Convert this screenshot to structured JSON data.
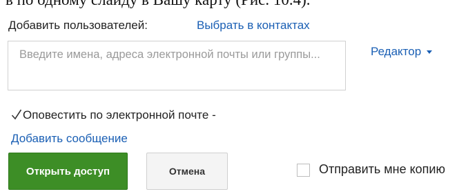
{
  "page_fragment": {
    "cropped_text": "в по одному слайду в Вашу карту (Рис. 10.4)."
  },
  "share_dialog": {
    "add_users_label": "Добавить пользователей:",
    "choose_contacts_link": "Выбрать в контактах",
    "people_input": {
      "value": "",
      "placeholder": "Введите имена, адреса электронной почты или группы..."
    },
    "role_select": {
      "selected": "Редактор",
      "icon": "caret-down-icon"
    },
    "notify": {
      "checked": true,
      "label": "Оповестить по электронной почте - ",
      "add_message_link": "Добавить сообщение"
    },
    "buttons": {
      "share": "Открыть доступ",
      "cancel": "Отмена"
    },
    "send_copy": {
      "checked": false,
      "label": "Отправить мне копию"
    }
  },
  "colors": {
    "link": "#1a5fb4",
    "primary_button": "#3d8e26",
    "placeholder": "#9a9a9a"
  }
}
